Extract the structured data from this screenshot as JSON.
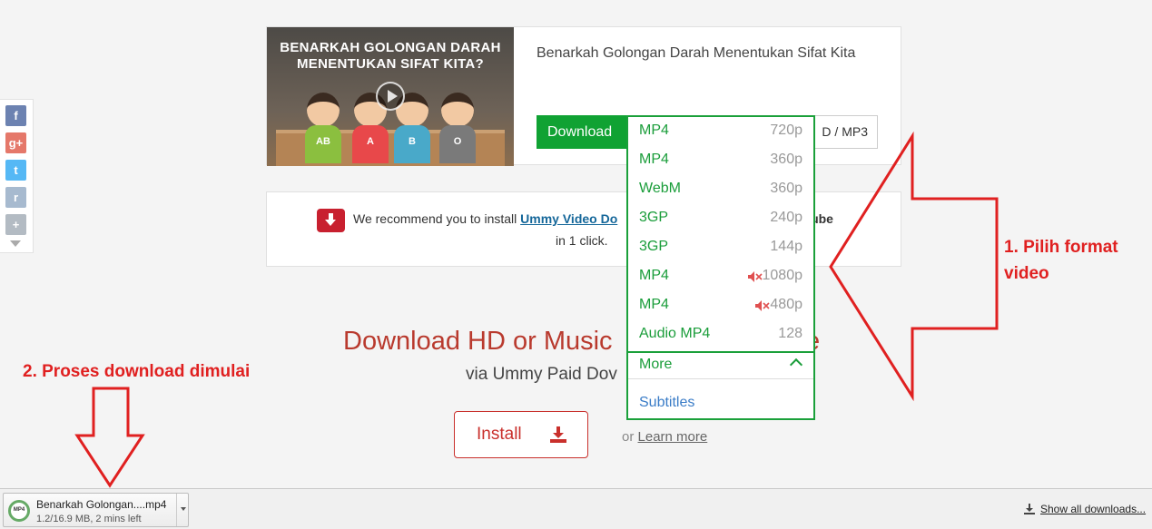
{
  "social": {
    "items": [
      {
        "icon": "facebook-icon",
        "glyph": "f",
        "color": "#3b5998"
      },
      {
        "icon": "google-plus-icon",
        "glyph": "g+",
        "color": "#dd4b39"
      },
      {
        "icon": "twitter-icon",
        "glyph": "t",
        "color": "#1da1f2"
      },
      {
        "icon": "reddit-icon",
        "glyph": "r",
        "color": "#8aa3c0"
      },
      {
        "icon": "more-share-icon",
        "glyph": "+",
        "color": "#9aa5b0"
      }
    ]
  },
  "video": {
    "thumbnail_title": "BENARKAH GOLONGAN DARAH MENENTUKAN SIFAT KITA?",
    "title": "Benarkah Golongan Darah Menentukan Sifat Kita",
    "kids": [
      "AB",
      "A",
      "B",
      "O"
    ],
    "download_label": "Download",
    "format_visible": "D / MP3"
  },
  "recommend": {
    "text_before": "We recommend you to install ",
    "link": "Ummy Video Do",
    "text_tail": "uTube",
    "line2": "in 1 click."
  },
  "promo": {
    "title": "Download HD or Music",
    "title_tail": "e",
    "subtitle": "via Ummy Paid Dov",
    "install_label": "Install",
    "or_text": "or",
    "learn_more": "Learn more"
  },
  "dropdown": {
    "items": [
      {
        "format": "MP4",
        "quality": "720p",
        "muted": false
      },
      {
        "format": "MP4",
        "quality": "360p",
        "muted": false
      },
      {
        "format": "WebM",
        "quality": "360p",
        "muted": false
      },
      {
        "format": "3GP",
        "quality": "240p",
        "muted": false
      },
      {
        "format": "3GP",
        "quality": "144p",
        "muted": false
      },
      {
        "format": "MP4",
        "quality": "1080p",
        "muted": true
      },
      {
        "format": "MP4",
        "quality": "480p",
        "muted": true
      },
      {
        "format": "Audio MP4",
        "quality": "128",
        "muted": false
      }
    ],
    "more_label": "More",
    "subtitles_label": "Subtitles"
  },
  "annotations": {
    "step1_line1": "1. Pilih format",
    "step1_line2": "video",
    "step2": "2. Proses download dimulai",
    "color": "#e02020"
  },
  "download_bar": {
    "file_name": "Benarkah Golongan....mp4",
    "status": "1.2/16.9 MB, 2 mins left",
    "show_all": "Show all downloads..."
  }
}
